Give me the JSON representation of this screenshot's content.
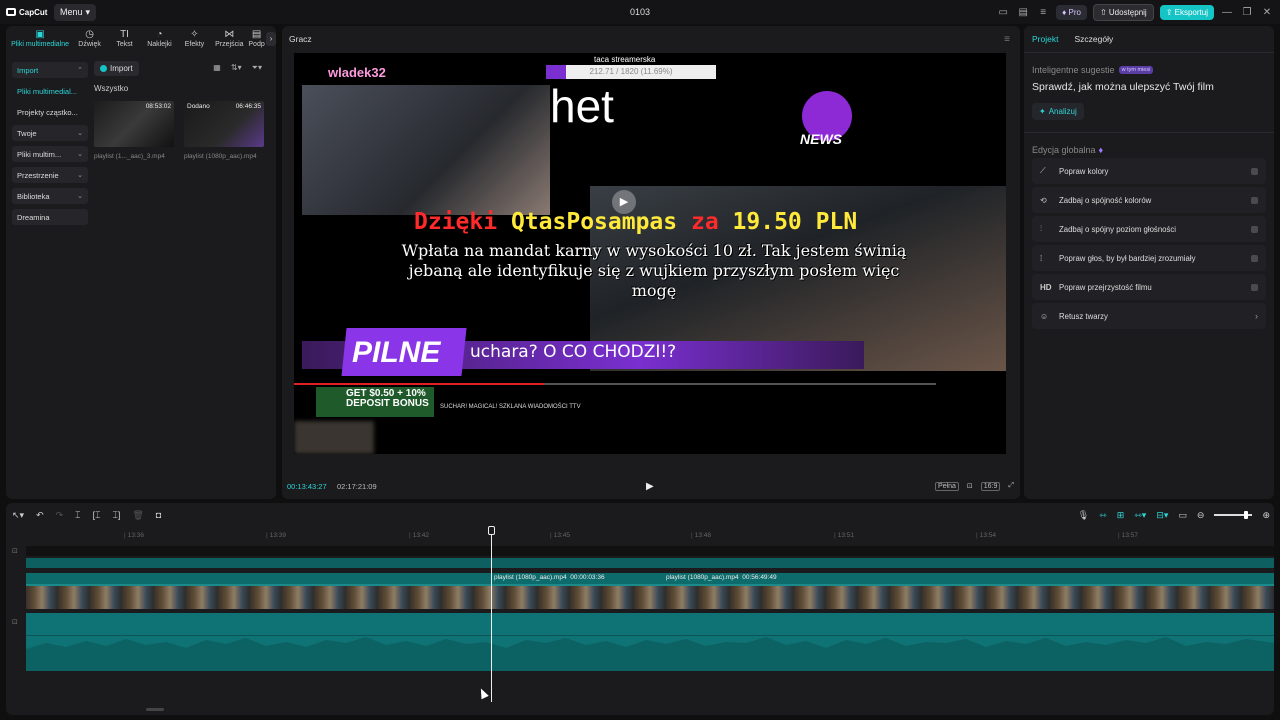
{
  "app": {
    "logo": "CapCut",
    "menu_label": "Menu",
    "window_title": "0103",
    "pro_label": "Pro",
    "share_label": "Udostępnij",
    "export_label": "Eksportuj",
    "accent": "#15c4c4"
  },
  "left": {
    "tabs": [
      {
        "label": "Pliki multimedialne",
        "icon": "media-icon"
      },
      {
        "label": "Dźwięk",
        "icon": "audio-icon"
      },
      {
        "label": "Tekst",
        "icon": "text-icon"
      },
      {
        "label": "Naklejki",
        "icon": "sticker-icon"
      },
      {
        "label": "Efekty",
        "icon": "effects-icon"
      },
      {
        "label": "Przejścia",
        "icon": "transitions-icon"
      },
      {
        "label": "Podp",
        "icon": "captions-icon"
      }
    ],
    "nav": [
      {
        "label": "Import"
      },
      {
        "label": "Pliki multimedial..."
      },
      {
        "label": "Projekty cząstko..."
      },
      {
        "label": "Twoje"
      },
      {
        "label": "Pliki multim..."
      },
      {
        "label": "Przestrzenie"
      },
      {
        "label": "Biblioteka"
      },
      {
        "label": "Dreamina"
      }
    ],
    "import_button": "Import",
    "all_label": "Wszystko",
    "media": [
      {
        "name": "playlist (1..._aac)_3.mp4",
        "duration": "08:53:02",
        "added": ""
      },
      {
        "name": "playlist (1080p_aac).mp4",
        "duration": "06:46:35",
        "added": "Dodano"
      }
    ]
  },
  "player": {
    "title": "Gracz",
    "current_time": "00:13:43:27",
    "total_time": "02:17:21:09",
    "full_label": "Pełna",
    "ratio_label": "16:9",
    "video": {
      "stream_title": "taca streamerska",
      "progress_text": "212.71 / 1820 (11.69%)",
      "donor_name": "wladek32",
      "het": "het",
      "news": "NEWS",
      "dzieki_1": "Dzięki",
      "dzieki_name": "QtasPosampas",
      "dzieki_2": "za",
      "dzieki_amount": "19.50 PLN",
      "message": "Wpłata na mandat karny w wysokości 10 zł. Tak jestem świnią jebaną ale identyfikuje się z wujkiem przyszłym posłem więc mogę",
      "pilne": "PILNE",
      "uchara": "uchara? O CO CHODZI!?",
      "bonus_1": "GET $0.50 + 10%",
      "bonus_2": "DEPOSIT BONUS",
      "yt_title": "SUCHAR! MAGICAL! SZKLANA WIADOMOŚCI TTV"
    }
  },
  "right": {
    "tab_project": "Projekt",
    "tab_details": "Szczegóły",
    "suggestions_head": "Inteligentne sugestie",
    "suggestions_badge": "w tym miesi",
    "suggestions_title": "Sprawdź, jak można ulepszyć Twój film",
    "analyze": "Analizuj",
    "global_head": "Edycja globalna",
    "items": [
      {
        "label": "Popraw kolory",
        "icon": "magic-wand-icon",
        "type": "toggle"
      },
      {
        "label": "Zadbaj o spójność kolorów",
        "icon": "color-link-icon",
        "type": "toggle"
      },
      {
        "label": "Zadbaj o spójny poziom głośności",
        "icon": "volume-sliders-icon",
        "type": "toggle"
      },
      {
        "label": "Popraw głos, by był bardziej zrozumiały",
        "icon": "voice-enhance-icon",
        "type": "toggle"
      },
      {
        "label": "Popraw przejrzystość filmu",
        "icon": "hd-icon",
        "type": "toggle"
      },
      {
        "label": "Retusz twarzy",
        "icon": "face-retouch-icon",
        "type": "arrow"
      }
    ]
  },
  "timeline": {
    "ticks": [
      "13:36",
      "13:39",
      "13:42",
      "13:45",
      "13:48",
      "13:51",
      "13:54",
      "13:57"
    ],
    "clips": [
      {
        "name": "playlist (1080p_aac).mp4",
        "duration": "00:00:03:36"
      },
      {
        "name": "playlist (1080p_aac).mp4",
        "duration": "00:56:49:49"
      }
    ]
  }
}
